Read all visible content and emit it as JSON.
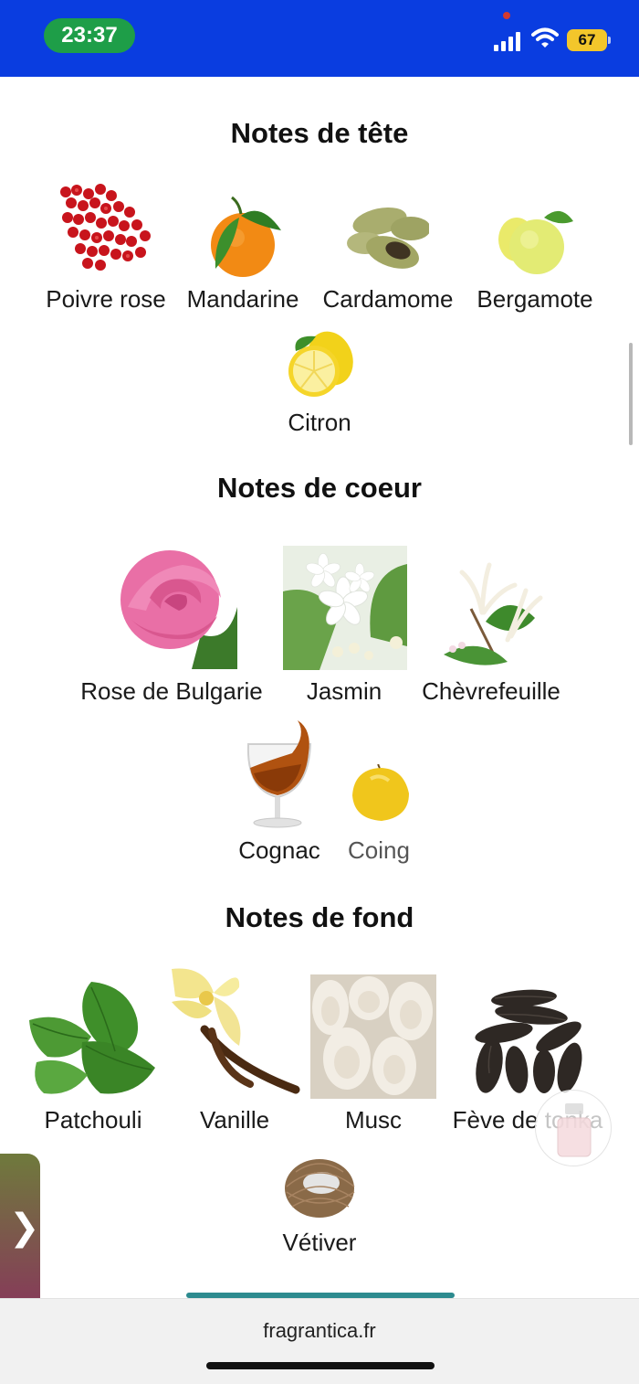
{
  "status": {
    "time": "23:37",
    "battery": "67"
  },
  "sections": {
    "top": {
      "title": "Notes de tête",
      "notes": [
        "Poivre rose",
        "Mandarine",
        "Cardamome",
        "Bergamote",
        "Citron"
      ]
    },
    "heart": {
      "title": "Notes de coeur",
      "notes": [
        "Rose de Bulgarie",
        "Jasmin",
        "Chèvrefeuille",
        "Cognac",
        "Coing"
      ]
    },
    "base": {
      "title": "Notes de fond",
      "notes": [
        "Patchouli",
        "Vanille",
        "Musc",
        "Fève de tonka",
        "Vétiver"
      ]
    }
  },
  "footer": {
    "url": "fragrantica.fr"
  },
  "icons": {
    "side_handle": "chevron-right-icon",
    "floating": "perfume-bottle-icon"
  },
  "colors": {
    "status_bar": "#0a3de0",
    "time_pill": "#1e9e48",
    "battery": "#f3c62b",
    "progress": "#2d8b8f"
  }
}
